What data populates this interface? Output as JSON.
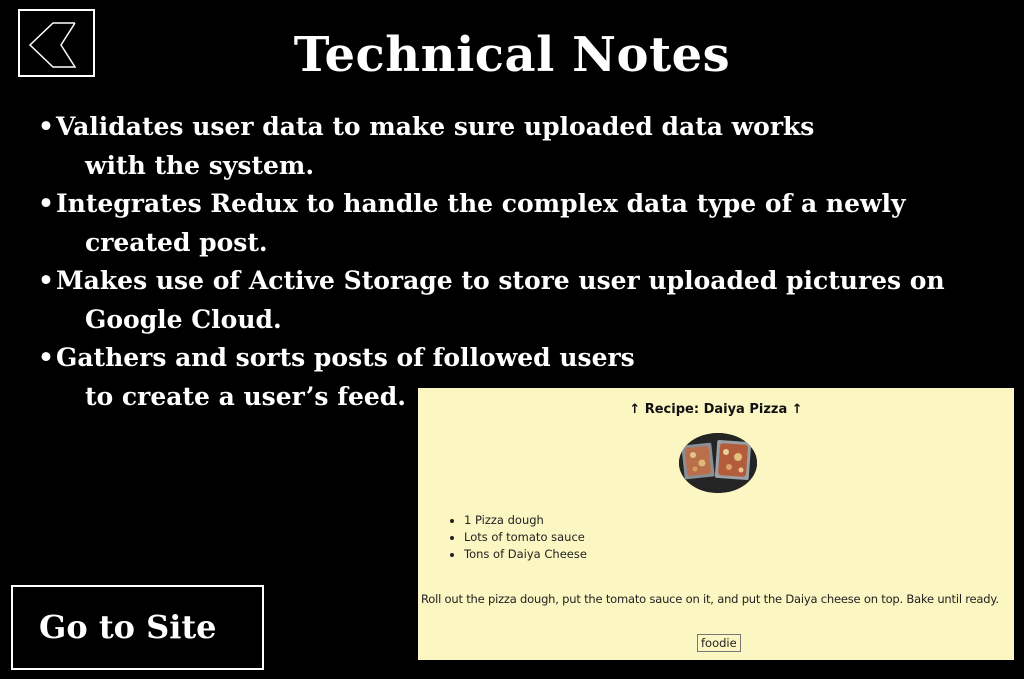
{
  "page": {
    "title": "Technical Notes",
    "back_icon": "chevron-left-icon",
    "go_to_site_label": "Go to Site"
  },
  "notes": [
    {
      "bullet": "•",
      "line1": "Validates user data to make sure uploaded data works",
      "line2": "with the system."
    },
    {
      "bullet": "•",
      "line1": "Integrates Redux to handle the complex data type of a newly",
      "line2": "created post."
    },
    {
      "bullet": "•",
      "line1": "Makes use of Active Storage to store user uploaded pictures on",
      "line2": "Google Cloud."
    },
    {
      "bullet": "•",
      "line1": "Gathers and sorts posts of followed users",
      "line2": "to create a user’s feed."
    }
  ],
  "preview": {
    "recipe_title": "↑ Recipe: Daiya Pizza ↑",
    "ingredients": [
      "1 Pizza dough",
      "Lots of tomato sauce",
      "Tons of Daiya Cheese"
    ],
    "instructions": "Roll out the pizza dough, put the tomato sauce on it, and put the Daiya cheese on top. Bake until ready.",
    "tag": "foodie",
    "background_color": "#fcf6c2"
  }
}
